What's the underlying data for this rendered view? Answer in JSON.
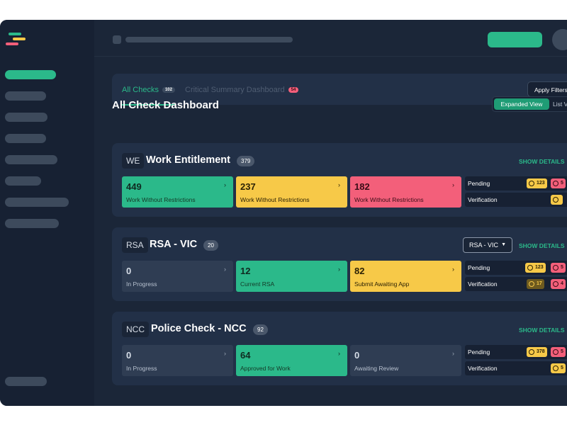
{
  "tabs": [
    {
      "label": "All Checks",
      "badge": "102"
    },
    {
      "label": "Critical Summary Dashboard",
      "badge": "54"
    }
  ],
  "apply_filters_label": "Apply Filters",
  "dashboard_title": "All Check Dashboard",
  "view_toggle": {
    "expanded": "Expanded View",
    "list": "List View"
  },
  "sections": [
    {
      "abbr": "WE",
      "title": "Work Entitlement",
      "count": "379",
      "show_details": "SHOW DETAILS",
      "stats": [
        {
          "value": "449",
          "label": "Work Without Restrictions",
          "arrow": "›"
        },
        {
          "value": "237",
          "label": "Work Without Restrictions",
          "arrow": "›"
        },
        {
          "value": "182",
          "label": "Work Without Restrictions",
          "arrow": "›"
        }
      ],
      "pending": {
        "label": "Pending",
        "chip1": "123",
        "chip2": "5"
      },
      "verification": {
        "label": "Verification",
        "chip1": ""
      }
    },
    {
      "abbr": "RSA",
      "title": "RSA - VIC",
      "count": "20",
      "region": "RSA - VIC",
      "show_details": "SHOW DETAILS",
      "stats": [
        {
          "value": "0",
          "label": "In Progress",
          "arrow": "›"
        },
        {
          "value": "12",
          "label": "Current RSA",
          "arrow": "›"
        },
        {
          "value": "82",
          "label": "Submit Awaiting App",
          "arrow": "›"
        }
      ],
      "pending": {
        "label": "Pending",
        "chip1": "123",
        "chip2": "5"
      },
      "verification": {
        "label": "Verification",
        "chip1": "17",
        "chip2": "4"
      }
    },
    {
      "abbr": "NCC",
      "title": "Police Check - NCC",
      "count": "92",
      "show_details": "SHOW DETAILS",
      "stats": [
        {
          "value": "0",
          "label": "In Progress",
          "arrow": "›"
        },
        {
          "value": "64",
          "label": "Approved for Work",
          "arrow": "›"
        },
        {
          "value": "0",
          "label": "Awaiting Review",
          "arrow": "›"
        }
      ],
      "pending": {
        "label": "Pending",
        "chip1": "378",
        "chip2": "5"
      },
      "verification": {
        "label": "Verification",
        "chip1": "5"
      }
    }
  ],
  "colors": {
    "accent": "#2bb98a",
    "warning": "#f7c948",
    "danger": "#f35f7a"
  }
}
